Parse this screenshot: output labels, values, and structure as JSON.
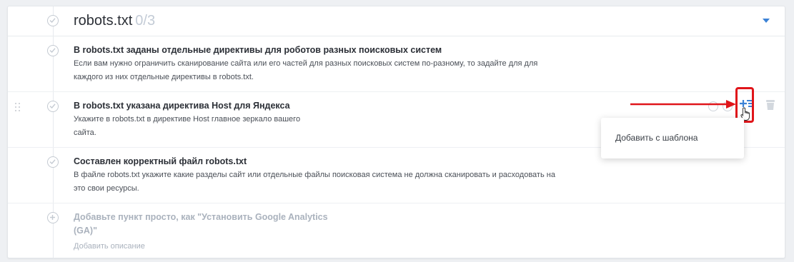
{
  "section": {
    "title": "robots.txt",
    "count": "0/3"
  },
  "items": [
    {
      "title": "В robots.txt заданы отдельные директивы для роботов разных поисковых систем",
      "desc_line1": "Если вам нужно ограничить сканирование сайта или его частей для разных поисковых систем по-разному, то задайте для для",
      "desc_line2": "каждого из них отдельные директивы в robots.txt."
    },
    {
      "title": "В robots.txt указана директива Host для Яндекса",
      "desc_line1": "Укажите в robots.txt в директиве Host главное зеркало вашего",
      "desc_line2": "сайта."
    },
    {
      "title": "Составлен корректный файл robots.txt",
      "desc_line1": "В файле robots.txt укажите какие разделы сайт или отдельные файлы поисковая система не должна сканировать и расходовать на",
      "desc_line2": "это свои ресурсы."
    }
  ],
  "add_item": {
    "title_line1": "Добавьте пункт просто, как \"Установить Google Analytics",
    "title_line2": "(GA)\"",
    "desc": "Добавить описание"
  },
  "popup": {
    "label": "Добавить с шаблона"
  },
  "icons": {
    "header_check": "check-circle-icon",
    "caret": "caret-down-icon",
    "drag": "drag-handle-icon",
    "add_template": "add-list-icon",
    "trash": "trash-icon",
    "cursor": "hand-pointer-icon",
    "arrow": "red-arrow-annotation"
  },
  "colors": {
    "accent": "#3b82d6",
    "annotation": "#e0151a",
    "muted": "#aab2bd"
  }
}
